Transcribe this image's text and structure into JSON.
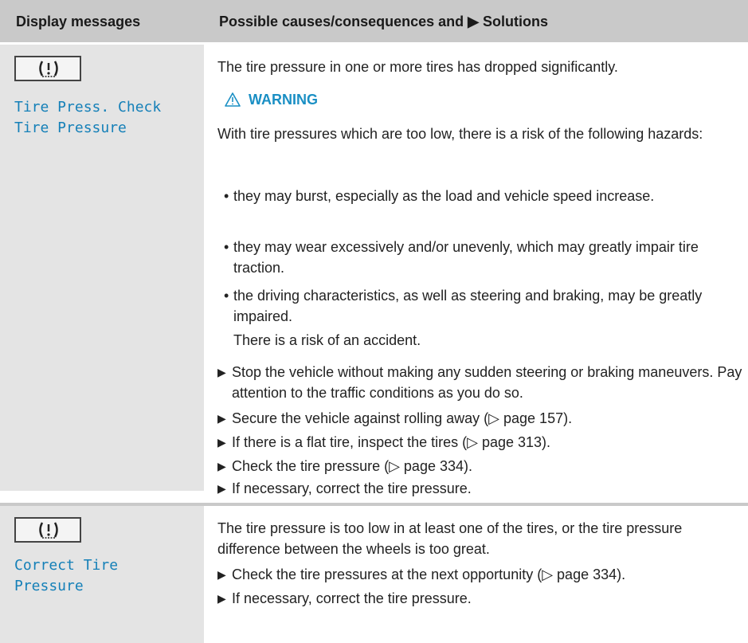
{
  "header": {
    "col1": "Display messages",
    "col2": "Possible causes/consequences and ▶ Solutions"
  },
  "icons": {
    "tire_pressure": "tire-pressure-warning-icon",
    "warning": "warning-triangle-icon",
    "step": "arrow-right-icon"
  },
  "colors": {
    "header_bg": "#c9c9c9",
    "left_bg": "#e4e4e4",
    "accent": "#1a8fc4"
  },
  "row1": {
    "display_line1": "Tire Press. Check",
    "display_line2": "Tire Pressure",
    "intro": "The tire pressure in one or more tires has dropped significantly.",
    "warning_label": "WARNING",
    "warning_text": "With tire pressures which are too low, there is a risk of the following hazards:",
    "bullets": [
      "they may burst, especially as the load and vehicle speed increase.",
      "they may wear excessively and/or unevenly, which may greatly impair tire traction.",
      "the driving characteristics, as well as steering and braking, may be greatly impaired."
    ],
    "accident": "There is a risk of an accident.",
    "steps": [
      "Stop the vehicle without making any sudden steering or braking maneuvers. Pay attention to the traffic conditions as you do so.",
      "Secure the vehicle against rolling away (▷ page 157).",
      "If there is a flat tire, inspect the tires (▷ page 313).",
      "Check the tire pressure (▷ page 334).",
      "If necessary, correct the tire pressure."
    ]
  },
  "row2": {
    "display_line1": "Correct Tire",
    "display_line2": "Pressure",
    "intro": "The tire pressure is too low in at least one of the tires, or the tire pressure difference between the wheels is too great.",
    "steps": [
      "Check the tire pressures at the next opportunity (▷ page 334).",
      "If necessary, correct the tire pressure."
    ]
  }
}
